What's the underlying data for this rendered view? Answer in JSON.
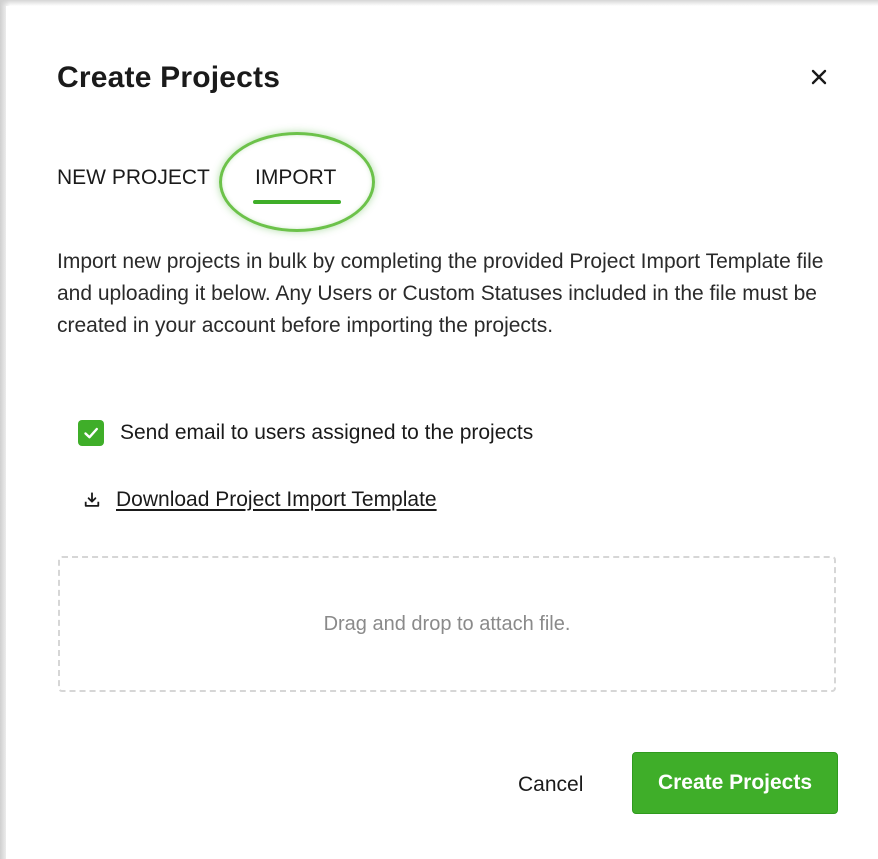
{
  "dialog": {
    "title": "Create Projects",
    "close_icon": "close-icon"
  },
  "tabs": [
    {
      "label": "NEW PROJECT",
      "active": false
    },
    {
      "label": "IMPORT",
      "active": true
    }
  ],
  "import": {
    "description": "Import new projects in bulk by completing the provided Project Import Template file and uploading it below. Any Users or Custom Statuses included in the file must be created in your account before importing the projects.",
    "send_email": {
      "label": "Send email to users assigned to the projects",
      "checked": true
    },
    "download_link": {
      "label": "Download Project Import Template",
      "icon": "download-icon"
    },
    "dropzone": {
      "text": "Drag and drop to attach file."
    }
  },
  "footer": {
    "cancel_label": "Cancel",
    "submit_label": "Create Projects"
  },
  "colors": {
    "accent": "#3fae29",
    "highlight_ring": "#6cc24a",
    "dropzone_border": "#d6d6d6",
    "muted_text": "#8a8a8a"
  }
}
